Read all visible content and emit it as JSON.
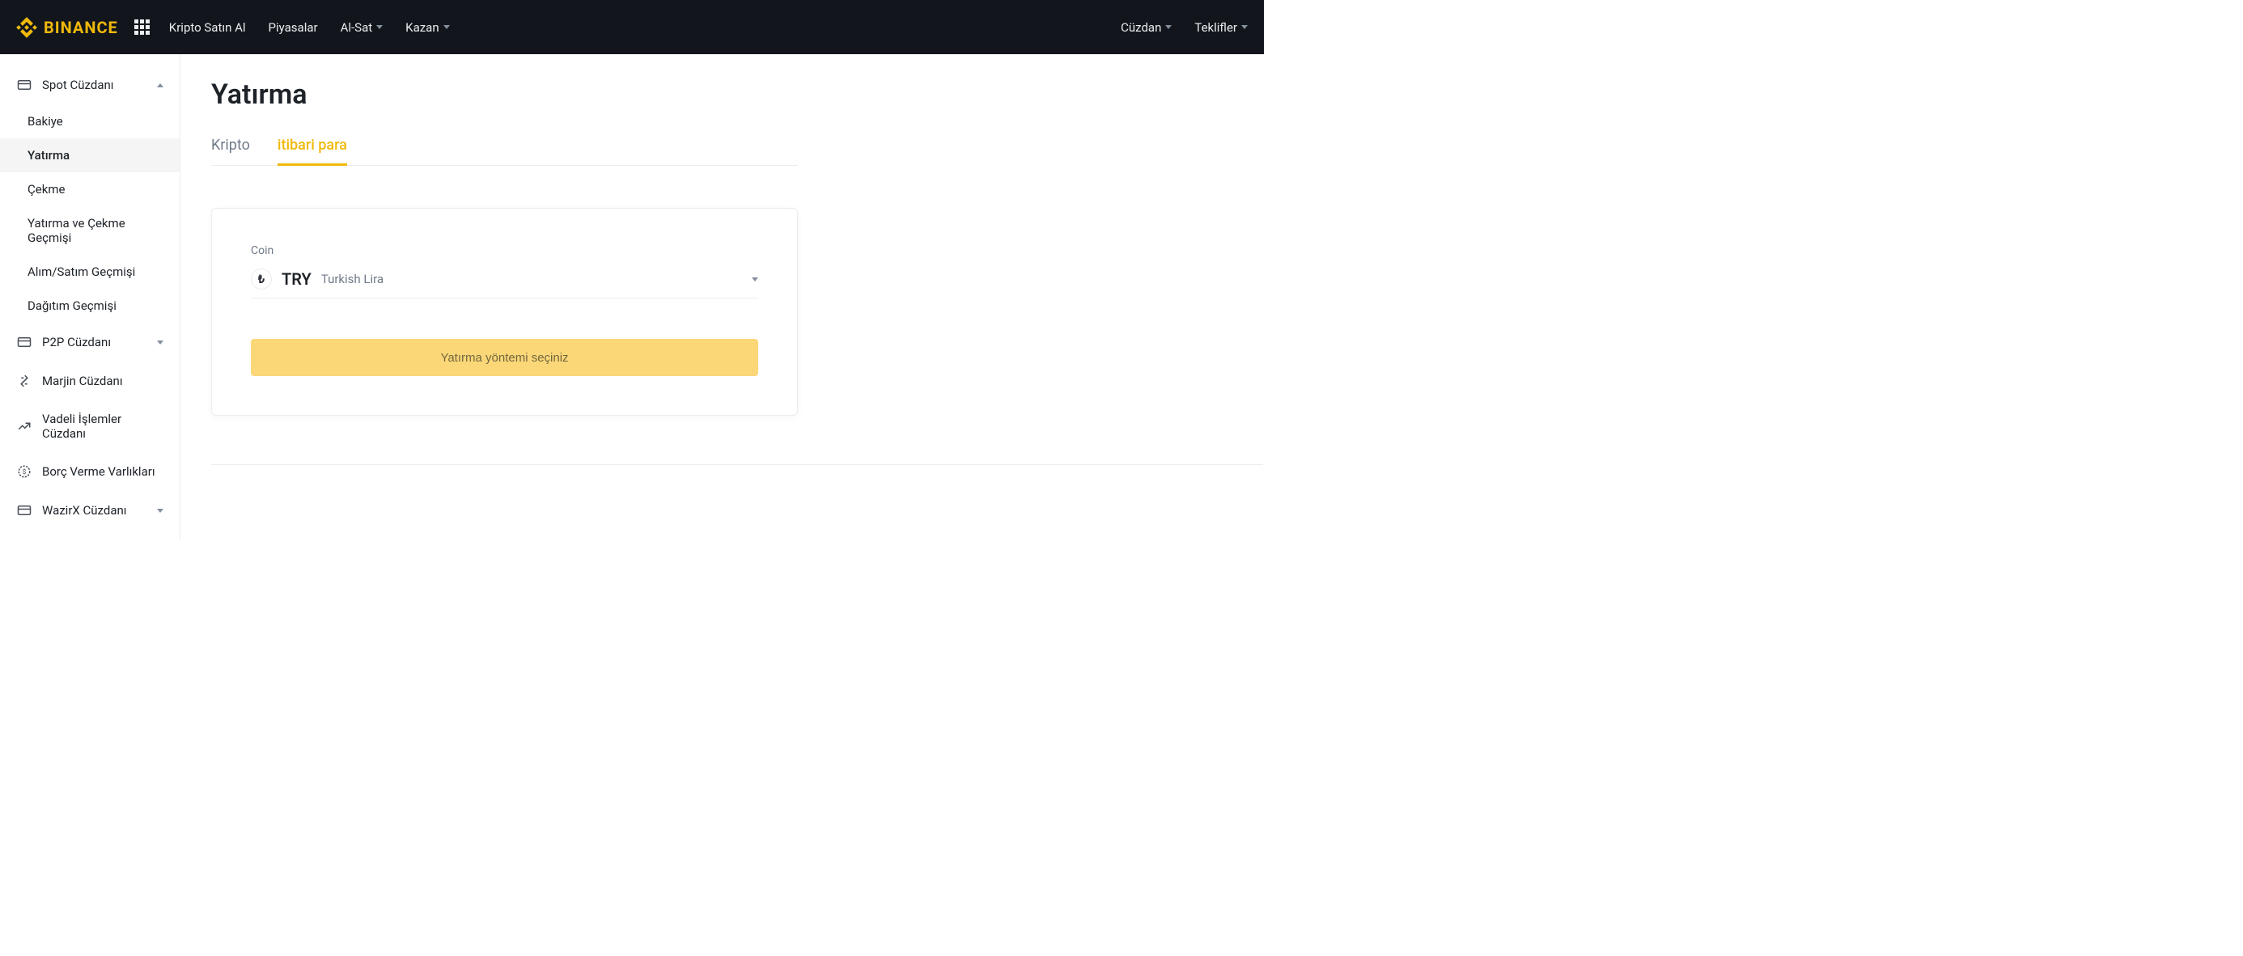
{
  "header": {
    "brand": "BINANCE",
    "nav_left": {
      "buy": "Kripto Satın Al",
      "markets": "Piyasalar",
      "trade": "Al-Sat",
      "earn": "Kazan"
    },
    "nav_right": {
      "wallet": "Cüzdan",
      "offers": "Teklifler"
    }
  },
  "sidebar": {
    "spot": "Spot Cüzdanı",
    "spot_items": {
      "balance": "Bakiye",
      "deposit": "Yatırma",
      "withdraw": "Çekme",
      "history": "Yatırma ve Çekme Geçmişi",
      "trade_history": "Alım/Satım Geçmişi",
      "dist_history": "Dağıtım Geçmişi"
    },
    "p2p": "P2P Cüzdanı",
    "margin": "Marjin Cüzdanı",
    "futures": "Vadeli İşlemler Cüzdanı",
    "lending": "Borç Verme Varlıkları",
    "wazirx": "WazirX Cüzdanı"
  },
  "main": {
    "title": "Yatırma",
    "tabs": {
      "crypto": "Kripto",
      "fiat": "itibari para"
    },
    "coin_label": "Coin",
    "coin_symbol": "₺",
    "coin_code": "TRY",
    "coin_name": "Turkish Lira",
    "method_button": "Yatırma yöntemi seçiniz"
  }
}
